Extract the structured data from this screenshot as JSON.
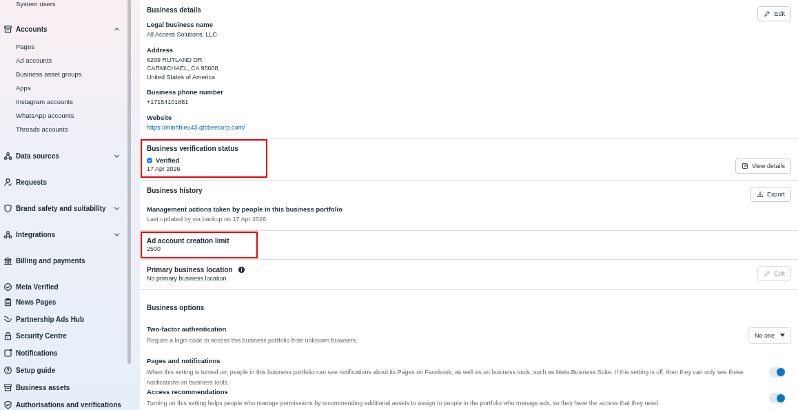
{
  "sidebar": {
    "items": [
      {
        "kind": "sub",
        "label": "System users"
      },
      {
        "kind": "group",
        "label": "Accounts",
        "expanded": true,
        "children": [
          {
            "label": "Pages"
          },
          {
            "label": "Ad accounts"
          },
          {
            "label": "Business asset groups"
          },
          {
            "label": "Apps"
          },
          {
            "label": "Instagram accounts"
          },
          {
            "label": "WhatsApp accounts"
          },
          {
            "label": "Threads accounts"
          }
        ]
      },
      {
        "kind": "group",
        "label": "Data sources",
        "expanded": false
      },
      {
        "kind": "link",
        "label": "Requests"
      },
      {
        "kind": "group",
        "label": "Brand safety and suitability",
        "expanded": false
      },
      {
        "kind": "group",
        "label": "Integrations",
        "expanded": false
      },
      {
        "kind": "link",
        "label": "Billing and payments"
      },
      {
        "kind": "link",
        "label": "Meta Verified"
      },
      {
        "kind": "link",
        "label": "News Pages"
      },
      {
        "kind": "link",
        "label": "Partnership Ads Hub"
      },
      {
        "kind": "link",
        "label": "Security Centre"
      },
      {
        "kind": "link",
        "label": "Notifications"
      },
      {
        "kind": "link",
        "label": "Setup guide"
      },
      {
        "kind": "link",
        "label": "Business assets"
      },
      {
        "kind": "link",
        "label": "Authorisations and verifications"
      }
    ]
  },
  "sections": [
    {
      "kind": "details",
      "highlighted": false,
      "title": "Business details",
      "button": {
        "label": "Edit",
        "disabled": false
      },
      "fields": [
        {
          "kind": "text",
          "label": "Legal business name",
          "lines": [
            "All Access Solutions, LLC"
          ]
        },
        {
          "kind": "text",
          "label": "Address",
          "lines": [
            "6209 RUTLAND DR",
            "CARMICHAEL, CA 95608",
            "United States of America"
          ]
        },
        {
          "kind": "text",
          "label": "Business phone number",
          "lines": [
            "+17154101881"
          ]
        },
        {
          "kind": "link",
          "label": "Website",
          "lines": [
            "https://minhhieu43.qtcbeecorp.com/"
          ]
        }
      ]
    },
    {
      "kind": "verification",
      "highlighted": true,
      "title": "Business verification status",
      "status": "Verified",
      "date": "17 Apr 2026",
      "button": {
        "label": "View details",
        "disabled": false
      }
    },
    {
      "kind": "history",
      "highlighted": false,
      "title": "Business history",
      "subtitle": "Management actions taken by people in this business portfolio",
      "note": "Last updated by via backup on 17 Apr 2026.",
      "button": {
        "label": "Export",
        "disabled": false
      }
    },
    {
      "kind": "value",
      "highlighted": true,
      "title": "Ad account creation limit",
      "value": "2500"
    },
    {
      "kind": "location",
      "highlighted": false,
      "title": "Primary business location",
      "value": "No primary business location",
      "button": {
        "label": "Edit",
        "disabled": true
      }
    },
    {
      "kind": "options",
      "highlighted": false,
      "title": "Business options",
      "settings": [
        {
          "kind": "dropdown",
          "label": "Two-factor authentication",
          "description": "Require a login code to access this business portfolio from unknown browsers.",
          "value": "No one"
        },
        {
          "kind": "toggle",
          "label": "Pages and notifications",
          "description": "When this setting is turned on, people in this business portfolio can see notifications about its Pages on Facebook, as well as on business tools, such as Meta Business Suite. If this setting is off, then they can only see these notifications on business tools.",
          "on": true
        },
        {
          "kind": "toggle",
          "label": "Access recommendations",
          "description": "Turning on this setting helps people who manage permissions by recommending additional assets to assign to people in the portfolio who manage ads, so they have the access that they need.",
          "on": true
        }
      ]
    }
  ]
}
